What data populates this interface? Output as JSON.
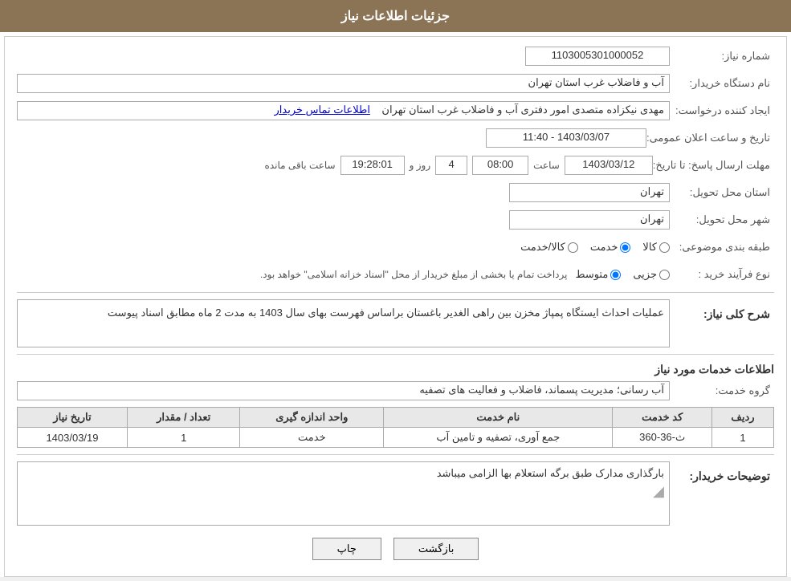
{
  "header": {
    "title": "جزئیات اطلاعات نیاز"
  },
  "fields": {
    "need_number_label": "شماره نیاز:",
    "need_number_value": "1103005301000052",
    "buyer_org_label": "نام دستگاه خریدار:",
    "buyer_org_value": "آب و فاضلاب غرب استان تهران",
    "creator_label": "ایجاد کننده درخواست:",
    "creator_value": "مهدی نیکزاده متصدی امور دفتری آب و فاضلاب غرب استان تهران",
    "contact_link": "اطلاعات تماس خریدار",
    "announce_datetime_label": "تاریخ و ساعت اعلان عمومی:",
    "announce_datetime_value": "1403/03/07 - 11:40",
    "response_deadline_label": "مهلت ارسال پاسخ: تا تاریخ:",
    "response_date": "1403/03/12",
    "response_time_label": "ساعت",
    "response_time_value": "08:00",
    "days_remaining_label": "روز و",
    "days_remaining_value": "4",
    "time_remaining_label": "ساعت باقی مانده",
    "time_remaining_value": "19:28:01",
    "province_label": "استان محل تحویل:",
    "province_value": "تهران",
    "city_label": "شهر محل تحویل:",
    "city_value": "تهران",
    "category_label": "طبقه بندی موضوعی:",
    "category_options": [
      {
        "id": "kala",
        "label": "کالا"
      },
      {
        "id": "khedmat",
        "label": "خدمت"
      },
      {
        "id": "kala_khedmat",
        "label": "کالا/خدمت"
      }
    ],
    "category_selected": "khedmat",
    "process_label": "نوع فرآیند خرید :",
    "process_options": [
      {
        "id": "jozvi",
        "label": "جزیی"
      },
      {
        "id": "motevaset",
        "label": "متوسط"
      }
    ],
    "process_selected": "motevaset",
    "process_note": "پرداخت تمام یا بخشی از مبلغ خریدار از محل \"اسناد خزانه اسلامی\" خواهد بود.",
    "need_description_label": "شرح کلی نیاز:",
    "need_description_value": "عملیات احداث ایستگاه پمپاژ مخزن بین راهی الغدیر باغستان براساس فهرست بهای سال 1403 به مدت 2 ماه مطابق اسناد پیوست",
    "services_info_label": "اطلاعات خدمات مورد نیاز",
    "service_group_label": "گروه خدمت:",
    "service_group_value": "آب رسانی؛ مدیریت پسماند، فاضلاب و فعالیت های تصفیه"
  },
  "table": {
    "headers": [
      "ردیف",
      "کد خدمت",
      "نام خدمت",
      "واحد اندازه گیری",
      "تعداد / مقدار",
      "تاریخ نیاز"
    ],
    "rows": [
      {
        "row": "1",
        "service_code": "ث-36-360",
        "service_name": "جمع آوری، تصفیه و تامین آب",
        "unit": "خدمت",
        "quantity": "1",
        "date": "1403/03/19"
      }
    ]
  },
  "buyer_notes": {
    "label": "توضیحات خریدار:",
    "text": "بارگذاری مدارک طبق برگه استعلام بها الزامی میباشد"
  },
  "buttons": {
    "print_label": "چاپ",
    "back_label": "بازگشت"
  }
}
